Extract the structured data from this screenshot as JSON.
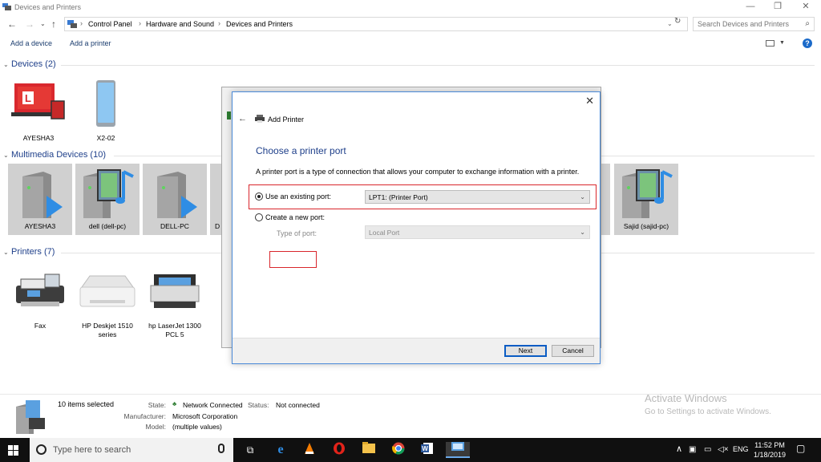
{
  "window": {
    "title": "Devices and Printers",
    "controls": {
      "minimize": "—",
      "restore": "❐",
      "close": "✕"
    }
  },
  "address": {
    "crumbs": [
      "Control Panel",
      "Hardware and Sound",
      "Devices and Printers"
    ],
    "search_placeholder": "Search Devices and Printers"
  },
  "commands": {
    "add_device": "Add a device",
    "add_printer": "Add a printer"
  },
  "sections": {
    "devices": {
      "title": "Devices (2)",
      "items": [
        "AYESHA3",
        "X2-02"
      ]
    },
    "multimedia": {
      "title": "Multimedia Devices (10)",
      "items": [
        "AYESHA3",
        "dell (dell-pc)",
        "DELL-PC",
        "D",
        "Sajid (sajid-pc)"
      ]
    },
    "printers": {
      "title": "Printers (7)",
      "items": [
        {
          "line1": "Fax",
          "line2": ""
        },
        {
          "line1": "HP Deskjet 1510",
          "line2": "series"
        },
        {
          "line1": "hp LaserJet 1300",
          "line2": "PCL 5"
        }
      ]
    }
  },
  "dialog": {
    "title": "Add Printer",
    "heading": "Choose a printer port",
    "description": "A printer port is a type of connection that allows your computer to exchange information with a printer.",
    "option_existing": "Use an existing port:",
    "existing_value": "LPT1: (Printer Port)",
    "option_new": "Create a new port:",
    "type_of_port_label": "Type of port:",
    "type_of_port_value": "Local Port",
    "next": "Next",
    "cancel": "Cancel"
  },
  "status": {
    "selected": "10 items selected",
    "state_label": "State:",
    "state_value": "Network Connected",
    "status_label": "Status:",
    "status_value": "Not connected",
    "manufacturer_label": "Manufacturer:",
    "manufacturer_value": "Microsoft Corporation",
    "model_label": "Model:",
    "model_value": "(multiple values)"
  },
  "watermark": {
    "line1": "Activate Windows",
    "line2": "Go to Settings to activate Windows."
  },
  "taskbar": {
    "search_placeholder": "Type here to search",
    "lang": "ENG",
    "time": "11:52 PM",
    "date": "1/18/2019"
  }
}
